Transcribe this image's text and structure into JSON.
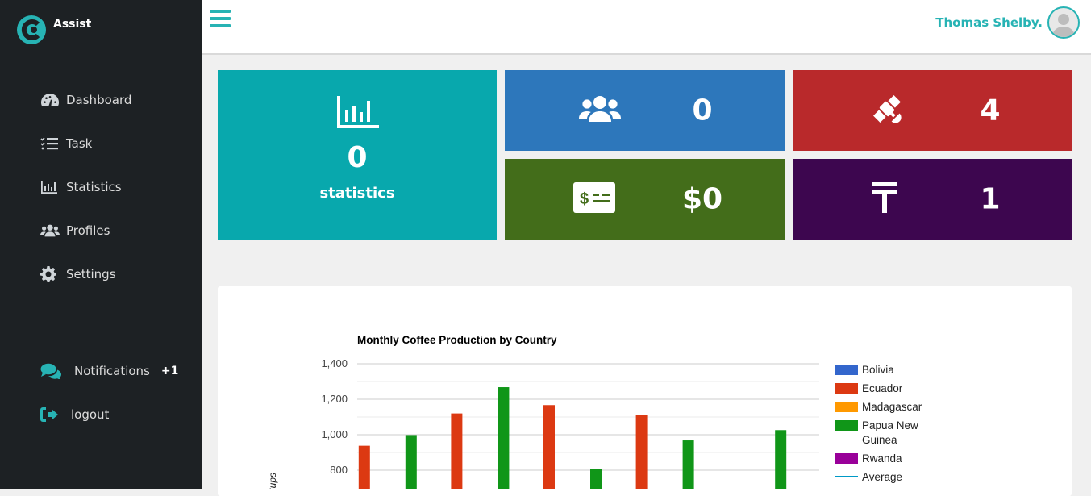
{
  "app": {
    "name": "Assist"
  },
  "sidebar": {
    "items": [
      {
        "label": "Dashboard",
        "icon": "dashboard-icon"
      },
      {
        "label": "Task",
        "icon": "tasks-icon"
      },
      {
        "label": "Statistics",
        "icon": "bar-chart-icon"
      },
      {
        "label": "Profiles",
        "icon": "users-icon"
      },
      {
        "label": "Settings",
        "icon": "gear-icon"
      }
    ],
    "notifications": {
      "label": "Notifications",
      "count": "+1",
      "icon": "comments-icon"
    },
    "logout": {
      "label": "logout",
      "icon": "sign-out-icon"
    }
  },
  "header": {
    "user_name": "Thomas Shelby."
  },
  "cards": {
    "statistics": {
      "value": "0",
      "label": "statistics",
      "color": "#08a8ad",
      "icon": "bar-chart-icon"
    },
    "users": {
      "value": "0",
      "color": "#2d77bb",
      "icon": "users-icon"
    },
    "satellite": {
      "value": "4",
      "color": "#b9292b",
      "icon": "satellite-icon"
    },
    "money": {
      "value": "$0",
      "color": "#436d1a",
      "icon": "money-bill-icon"
    },
    "tenge": {
      "value": "1",
      "color": "#3d064f",
      "icon": "tenge-icon"
    }
  },
  "colors": {
    "accent": "#27b3b4",
    "sidebar_bg": "#1d2124"
  },
  "chart_data": {
    "type": "bar",
    "title": "Monthly Coffee Production by Country",
    "ylabel": "Cups",
    "yticks": [
      "800",
      "1,000",
      "1,200",
      "1,400"
    ],
    "ylim_visible": [
      800,
      1400
    ],
    "grid": true,
    "legend_position": "right",
    "groups": 5,
    "series": [
      {
        "name": "Bolivia",
        "color": "#3366cc",
        "values": [
          null,
          null,
          null,
          null,
          null
        ]
      },
      {
        "name": "Ecuador",
        "color": "#dc3912",
        "values": [
          938,
          1120,
          1167,
          1110,
          null
        ]
      },
      {
        "name": "Madagascar",
        "color": "#ff9900",
        "values": [
          null,
          null,
          null,
          null,
          null
        ]
      },
      {
        "name": "Papua New Guinea",
        "color": "#109618",
        "values": [
          998,
          1268,
          807,
          968,
          1026
        ]
      },
      {
        "name": "Rwanda",
        "color": "#990099",
        "values": [
          null,
          null,
          null,
          null,
          null
        ]
      }
    ],
    "average": {
      "name": "Average",
      "color": "#0099c6"
    }
  }
}
